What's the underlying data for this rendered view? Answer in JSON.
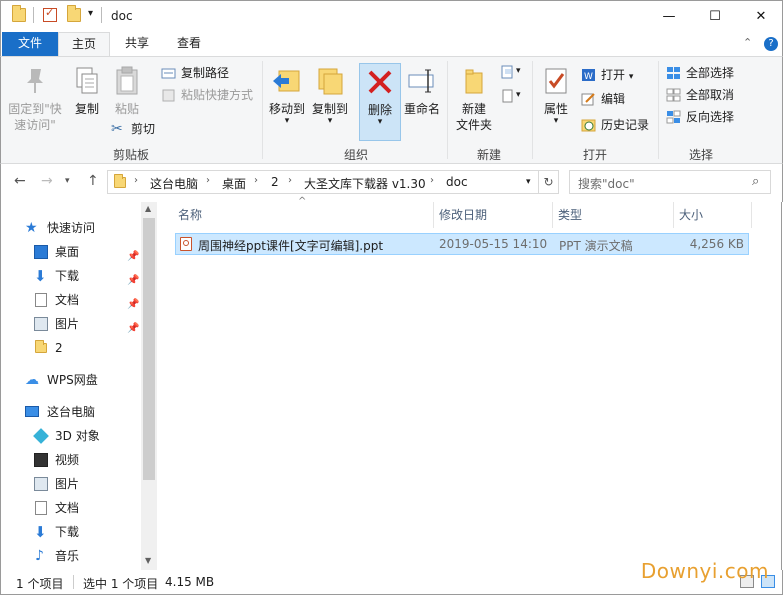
{
  "window": {
    "title": "doc",
    "controls": {
      "minimize": "—",
      "maximize": "☐",
      "close": "✕"
    }
  },
  "ribbon_tabs": {
    "file": "文件",
    "home": "主页",
    "share": "共享",
    "view": "查看"
  },
  "ribbon": {
    "clipboard": {
      "pin": "固定到\"快\n速访问\"",
      "copy": "复制",
      "paste": "粘贴",
      "copy_path": "复制路径",
      "paste_shortcut": "粘贴快捷方式",
      "cut": "剪切",
      "label": "剪贴板"
    },
    "organize": {
      "move_to": "移动到",
      "copy_to": "复制到",
      "delete": "删除",
      "rename": "重命名",
      "label": "组织"
    },
    "new": {
      "new_folder": "新建\n文件夹",
      "label": "新建"
    },
    "open": {
      "properties": "属性",
      "open": "打开",
      "edit": "编辑",
      "history": "历史记录",
      "label": "打开"
    },
    "select": {
      "select_all": "全部选择",
      "select_none": "全部取消",
      "invert": "反向选择",
      "label": "选择"
    }
  },
  "address": {
    "crumbs": [
      "这台电脑",
      "桌面",
      "2",
      "大圣文库下载器 v1.30",
      "doc"
    ],
    "search_placeholder": "搜索\"doc\""
  },
  "nav": {
    "quick_access": "快速访问",
    "quick_items": [
      "桌面",
      "下载",
      "文档",
      "图片",
      "2"
    ],
    "wps": "WPS网盘",
    "this_pc": "这台电脑",
    "pc_items": [
      "3D 对象",
      "视频",
      "图片",
      "文档",
      "下载",
      "音乐"
    ]
  },
  "columns": {
    "name": "名称",
    "date": "修改日期",
    "type": "类型",
    "size": "大小"
  },
  "files": [
    {
      "name": "周围神经ppt课件[文字可编辑].ppt",
      "date": "2019-05-15 14:10",
      "type": "PPT 演示文稿",
      "size": "4,256 KB"
    }
  ],
  "status": {
    "count": "1 个项目",
    "selected": "选中 1 个项目",
    "size": "4.15 MB"
  },
  "watermark": "Downyi.com",
  "colors": {
    "accent": "#1a6fc8",
    "selection": "#cce8ff",
    "folder": "#f8d775"
  }
}
